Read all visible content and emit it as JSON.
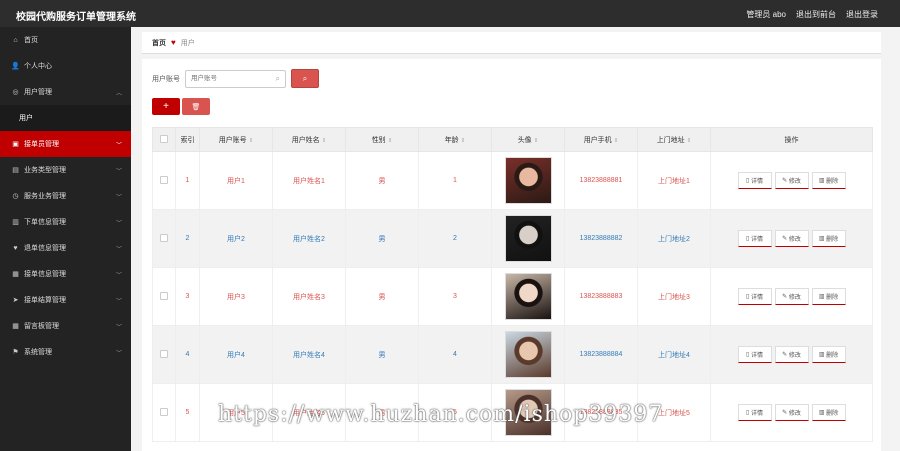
{
  "app": {
    "title": "校园代购服务订单管理系统"
  },
  "topbar": {
    "admin": "管理员 abo",
    "back": "退出到前台",
    "logout": "退出登录"
  },
  "sidebar": {
    "items": [
      {
        "label": "首页",
        "icon": "home-icon"
      },
      {
        "label": "个人中心",
        "icon": "user-icon"
      },
      {
        "label": "用户管理",
        "icon": "users-icon"
      },
      {
        "label": "用户",
        "sub": true
      },
      {
        "label": "接单员管理",
        "icon": "courier-icon",
        "active": true
      },
      {
        "label": "业务类型管理",
        "icon": "briefcase-icon"
      },
      {
        "label": "服务业务管理",
        "icon": "clock-icon"
      },
      {
        "label": "下单信息管理",
        "icon": "order-icon"
      },
      {
        "label": "退单信息管理",
        "icon": "return-icon"
      },
      {
        "label": "接单信息管理",
        "icon": "accept-icon"
      },
      {
        "label": "接单结算管理",
        "icon": "send-icon"
      },
      {
        "label": "留言板管理",
        "icon": "grid-icon"
      },
      {
        "label": "系统管理",
        "icon": "flag-icon"
      }
    ]
  },
  "breadcrumb": {
    "home": "首页",
    "current": "用户"
  },
  "search": {
    "label": "用户账号",
    "placeholder": "用户账号"
  },
  "table": {
    "headers": [
      "索引",
      "用户账号",
      "用户姓名",
      "性别",
      "年龄",
      "头像",
      "用户手机",
      "上门地址",
      "操作"
    ],
    "rows": [
      {
        "index": "1",
        "account": "用户1",
        "name": "用户姓名1",
        "gender": "男",
        "age": "1",
        "phone": "13823888881",
        "address": "上门地址1",
        "color": "red"
      },
      {
        "index": "2",
        "account": "用户2",
        "name": "用户姓名2",
        "gender": "男",
        "age": "2",
        "phone": "13823888882",
        "address": "上门地址2",
        "color": "blue"
      },
      {
        "index": "3",
        "account": "用户3",
        "name": "用户姓名3",
        "gender": "男",
        "age": "3",
        "phone": "13823888883",
        "address": "上门地址3",
        "color": "red"
      },
      {
        "index": "4",
        "account": "用户4",
        "name": "用户姓名4",
        "gender": "男",
        "age": "4",
        "phone": "13823888884",
        "address": "上门地址4",
        "color": "blue"
      },
      {
        "index": "5",
        "account": "用户5",
        "name": "用户姓名5",
        "gender": "男",
        "age": "5",
        "phone": "13823888885",
        "address": "上门地址5",
        "color": "red"
      }
    ],
    "actions": {
      "detail": "详情",
      "edit": "修改",
      "delete": "删除"
    }
  },
  "watermark": "https://www.huzhan.com/ishop39397"
}
